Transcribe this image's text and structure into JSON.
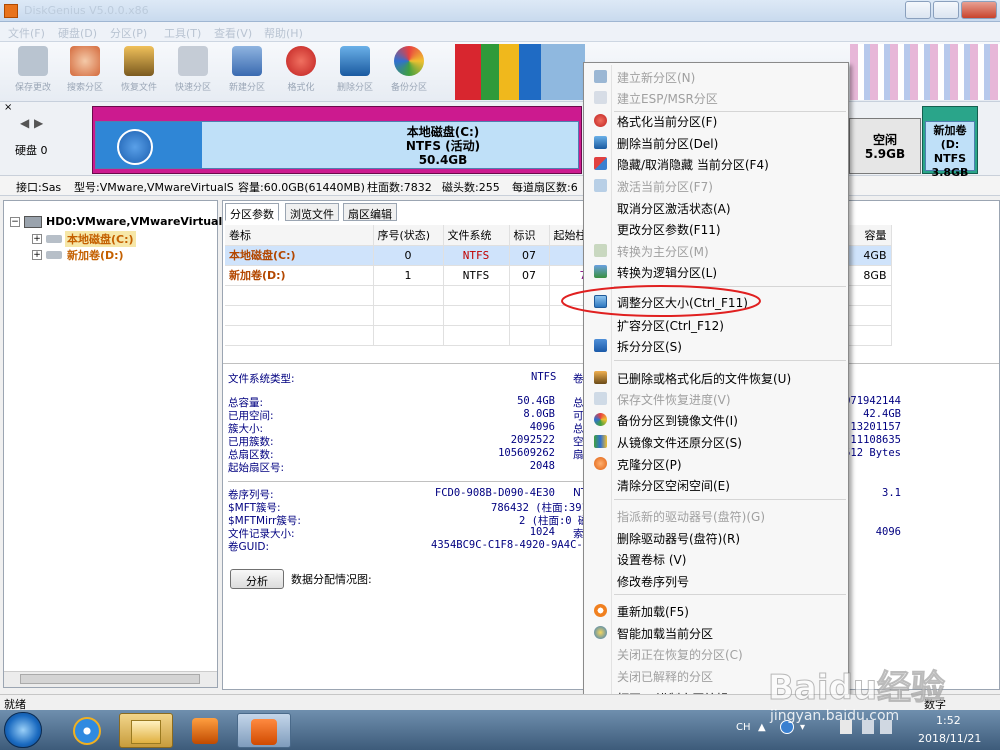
{
  "window": {
    "title": "DiskGenius V5.0.0.x86"
  },
  "menubar": {
    "items": [
      "文件(F)",
      "硬盘(D)",
      "分区(P)",
      "工具(T)",
      "查看(V)",
      "帮助(H)"
    ]
  },
  "toolbar": {
    "buttons": [
      "保存更改",
      "搜索分区",
      "恢复文件",
      "快速分区",
      "新建分区",
      "格式化",
      "删除分区",
      "备份分区"
    ]
  },
  "disk_strip": {
    "nav_left": "◀",
    "nav_right": "▶",
    "disk_label": "硬盘 0",
    "partition_c": {
      "name": "本地磁盘(C:)",
      "fs": "NTFS (活动)",
      "size": "50.4GB"
    },
    "free": {
      "name": "空闲",
      "size": "5.9GB"
    },
    "partition_d": {
      "name": "新加卷(D:",
      "fs": "NTFS",
      "size": "3.8GB"
    }
  },
  "disk_info": {
    "interface": "接口:Sas",
    "model": "型号:VMware,VMwareVirtualS",
    "capacity": "容量:60.0GB(61440MB)",
    "cylinders": "柱面数:7832",
    "heads": "磁头数:255",
    "sectors": "每道扇区数:6"
  },
  "tree": {
    "root": "HD0:VMware,VMwareVirtualS",
    "children": [
      "本地磁盘(C:)",
      "新加卷(D:)"
    ]
  },
  "tabs": [
    "分区参数",
    "浏览文件",
    "扇区编辑"
  ],
  "partition_table": {
    "headers": [
      "卷标",
      "序号(状态)",
      "文件系统",
      "标识",
      "起始柱",
      "容量"
    ],
    "rows": [
      {
        "label": "本地磁盘(C:)",
        "index": "0",
        "fs": "NTFS",
        "id": "07",
        "start": "",
        "size": "4GB"
      },
      {
        "label": "新加卷(D:)",
        "index": "1",
        "fs": "NTFS",
        "id": "07",
        "start": "7",
        "size": "8GB"
      }
    ]
  },
  "fs_type": {
    "label": "文件系统类型:",
    "value": "NTFS",
    "right_label": "卷"
  },
  "props_left": [
    {
      "label": "总容量:",
      "value": "50.4GB",
      "mid": "总"
    },
    {
      "label": "已用空间:",
      "value": "8.0GB",
      "mid": "可"
    },
    {
      "label": "簇大小:",
      "value": "4096",
      "mid": "总"
    },
    {
      "label": "已用簇数:",
      "value": "2092522",
      "mid": "空"
    },
    {
      "label": "总扇区数:",
      "value": "105609262",
      "mid": "扇"
    },
    {
      "label": "起始扇区号:",
      "value": "2048",
      "mid": ""
    }
  ],
  "props_right": [
    "071942144",
    "42.4GB",
    "13201157",
    "11108635",
    "512 Bytes"
  ],
  "props_ntfs": [
    {
      "label": "卷序列号:",
      "value": "FCD0-908B-D090-4E30",
      "mid": "NT"
    },
    {
      "label": "$MFT簇号:",
      "value": "786432 (柱面:391",
      "mid": ""
    },
    {
      "label": "$MFTMirr簇号:",
      "value": "2 (柱面:0 磁",
      "mid": ""
    },
    {
      "label": "文件记录大小:",
      "value": "1024",
      "mid": "索"
    },
    {
      "label": "卷GUID:",
      "value": "4354BC9C-C1F8-4920-9A4C-B1",
      "mid": ""
    }
  ],
  "props_ntfs_right": [
    "3.1",
    "4096"
  ],
  "analyze": {
    "button": "分析",
    "label": "数据分配情况图:"
  },
  "context_menu": {
    "items": [
      {
        "text": "建立新分区(N)",
        "disabled": true,
        "icon": "new-partition-icon"
      },
      {
        "text": "建立ESP/MSR分区",
        "disabled": true,
        "icon": "esp-icon"
      },
      {
        "text": "格式化当前分区(F)",
        "disabled": false,
        "icon": "format-icon"
      },
      {
        "text": "删除当前分区(Del)",
        "disabled": false,
        "icon": "delete-icon"
      },
      {
        "text": "隐藏/取消隐藏 当前分区(F4)",
        "disabled": false,
        "icon": "hide-icon"
      },
      {
        "text": "激活当前分区(F7)",
        "disabled": true,
        "icon": "activate-icon"
      },
      {
        "text": "取消分区激活状态(A)",
        "disabled": false,
        "icon": ""
      },
      {
        "text": "更改分区参数(F11)",
        "disabled": false,
        "icon": ""
      },
      {
        "text": "转换为主分区(M)",
        "disabled": true,
        "icon": "convert-primary-icon"
      },
      {
        "text": "转换为逻辑分区(L)",
        "disabled": false,
        "icon": "convert-logical-icon"
      },
      {
        "text": "调整分区大小(Ctrl_F11)",
        "disabled": false,
        "icon": "resize-icon"
      },
      {
        "text": "扩容分区(Ctrl_F12)",
        "disabled": false,
        "icon": ""
      },
      {
        "text": "拆分分区(S)",
        "disabled": false,
        "icon": "split-icon"
      },
      {
        "text": "已删除或格式化后的文件恢复(U)",
        "disabled": false,
        "icon": "recover-icon"
      },
      {
        "text": "保存文件恢复进度(V)",
        "disabled": true,
        "icon": "save-progress-icon"
      },
      {
        "text": "备份分区到镜像文件(I)",
        "disabled": false,
        "icon": "backup-icon"
      },
      {
        "text": "从镜像文件还原分区(S)",
        "disabled": false,
        "icon": "restore-icon"
      },
      {
        "text": "克隆分区(P)",
        "disabled": false,
        "icon": "clone-icon"
      },
      {
        "text": "清除分区空闲空间(E)",
        "disabled": false,
        "icon": ""
      },
      {
        "text": "指派新的驱动器号(盘符)(G)",
        "disabled": true,
        "icon": ""
      },
      {
        "text": "删除驱动器号(盘符)(R)",
        "disabled": false,
        "icon": ""
      },
      {
        "text": "设置卷标 (V)",
        "disabled": false,
        "icon": ""
      },
      {
        "text": "修改卷序列号",
        "disabled": false,
        "icon": ""
      },
      {
        "text": "重新加载(F5)",
        "disabled": false,
        "icon": "reload-icon"
      },
      {
        "text": "智能加载当前分区",
        "disabled": false,
        "icon": "smart-load-icon"
      },
      {
        "text": "关闭正在恢复的分区(C)",
        "disabled": true,
        "icon": ""
      },
      {
        "text": "关闭已解释的分区",
        "disabled": true,
        "icon": ""
      },
      {
        "text": "打开16进制扇区编辑",
        "disabled": false,
        "icon": ""
      }
    ]
  },
  "statusbar": {
    "left": "就绪",
    "right": "数字"
  },
  "taskbar": {
    "lang": "CH",
    "time": "1:52",
    "date": "2018/11/21"
  },
  "watermark": {
    "text": "Baidu经验",
    "url": "jingyan.baidu.com"
  }
}
